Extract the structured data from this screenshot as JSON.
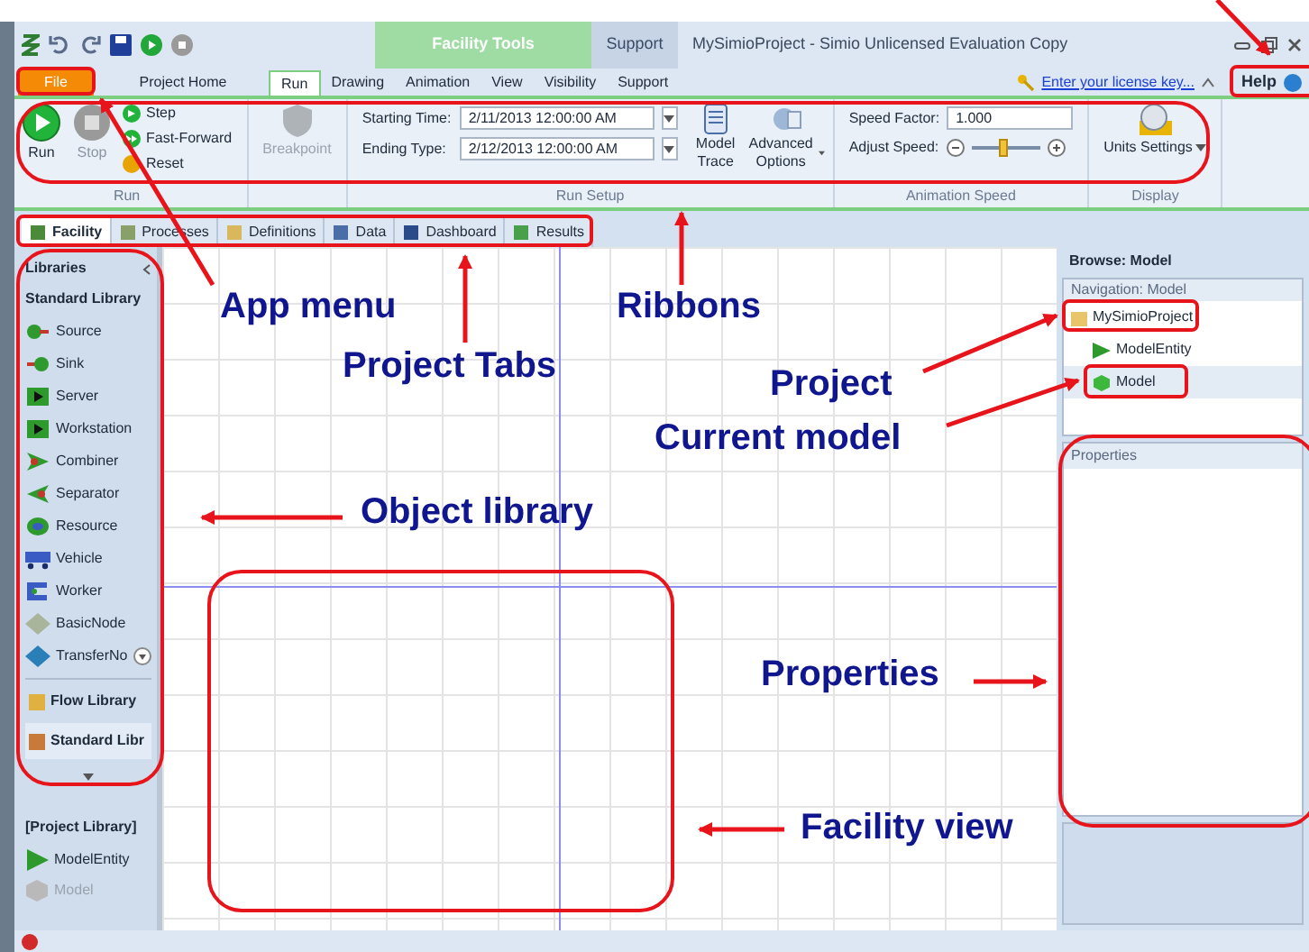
{
  "title_bar": {
    "context_tab": "Facility Tools",
    "support_tab": "Support",
    "title": "MySimioProject - Simio Unlicensed Evaluation Copy"
  },
  "ribbon_tabs": [
    {
      "label": "File",
      "kind": "app",
      "selected": false
    },
    {
      "label": "Project Home",
      "kind": "tab",
      "selected": false
    },
    {
      "label": "Run",
      "kind": "tab",
      "selected": true
    },
    {
      "label": "Drawing",
      "kind": "tab",
      "selected": false
    },
    {
      "label": "Animation",
      "kind": "tab",
      "selected": false
    },
    {
      "label": "View",
      "kind": "tab",
      "selected": false
    },
    {
      "label": "Visibility",
      "kind": "tab",
      "selected": false
    },
    {
      "label": "Support",
      "kind": "tab",
      "selected": false
    }
  ],
  "license_link": "Enter your license key...",
  "help": "Help",
  "run_group": {
    "label": "Run",
    "run": "Run",
    "stop": "Stop",
    "stop_disabled": true,
    "step": "Step",
    "fast_forward": "Fast-Forward",
    "reset": "Reset"
  },
  "breakpoint": {
    "label": "Breakpoint",
    "disabled": true
  },
  "run_setup": {
    "label": "Run Setup",
    "starting_time_label": "Starting Time:",
    "starting_time": "2/11/2013 12:00:00 AM",
    "ending_type_label": "Ending Type:",
    "ending_type": "2/12/2013 12:00:00 AM",
    "model_trace": "Model Trace",
    "advanced_options": "Advanced Options"
  },
  "animation_speed": {
    "label": "Animation Speed",
    "speed_factor_label": "Speed Factor:",
    "speed_factor": "1.000",
    "adjust_speed_label": "Adjust Speed:",
    "level": 0.45
  },
  "display": {
    "label": "Display",
    "units_settings": "Units Settings"
  },
  "project_tabs": [
    {
      "label": "Facility",
      "selected": true
    },
    {
      "label": "Processes",
      "selected": false
    },
    {
      "label": "Definitions",
      "selected": false
    },
    {
      "label": "Data",
      "selected": false
    },
    {
      "label": "Dashboard",
      "selected": false
    },
    {
      "label": "Results",
      "selected": false
    }
  ],
  "libraries": {
    "title": "Libraries",
    "section": "Standard Library",
    "items": [
      {
        "label": "Source",
        "kind": "source"
      },
      {
        "label": "Sink",
        "kind": "sink"
      },
      {
        "label": "Server",
        "kind": "server"
      },
      {
        "label": "Workstation",
        "kind": "server"
      },
      {
        "label": "Combiner",
        "kind": "combiner"
      },
      {
        "label": "Separator",
        "kind": "separator"
      },
      {
        "label": "Resource",
        "kind": "resource"
      },
      {
        "label": "Vehicle",
        "kind": "vehicle"
      },
      {
        "label": "Worker",
        "kind": "worker"
      },
      {
        "label": "BasicNode",
        "kind": "basicnode"
      },
      {
        "label": "TransferNo",
        "kind": "transfernode"
      }
    ],
    "library_buttons": [
      "Flow Library",
      "Standard Libr"
    ],
    "project_library": "[Project Library]",
    "project_items": [
      {
        "label": "ModelEntity",
        "disabled": false
      },
      {
        "label": "Model",
        "disabled": true
      }
    ]
  },
  "browse": {
    "title": "Browse: Model",
    "navigation_title": "Navigation: Model",
    "tree": [
      {
        "label": "MySimioProject",
        "selected": false,
        "children": [
          {
            "label": "ModelEntity",
            "selected": false
          },
          {
            "label": "Model",
            "selected": true
          }
        ]
      }
    ]
  },
  "properties": {
    "title": "Properties"
  },
  "annotations": [
    {
      "label": "App menu"
    },
    {
      "label": "Project Tabs"
    },
    {
      "label": "Ribbons"
    },
    {
      "label": "Project"
    },
    {
      "label": "Current model"
    },
    {
      "label": "Object library"
    },
    {
      "label": "Properties"
    },
    {
      "label": "Facility view"
    }
  ]
}
